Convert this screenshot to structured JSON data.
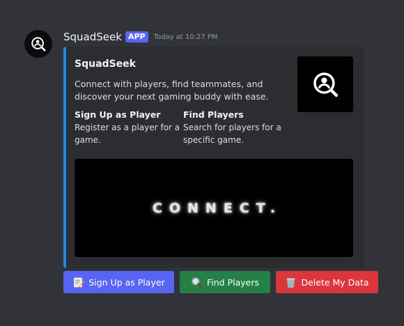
{
  "message": {
    "avatar_icon": "person-search-icon",
    "username": "SquadSeek",
    "badge": "APP",
    "timestamp": "Today at 10:27 PM"
  },
  "embed": {
    "accent_color": "#1e8be0",
    "title": "SquadSeek",
    "description": "Connect with players, find teammates, and discover your next gaming buddy with ease.",
    "thumbnail_icon": "person-search-icon",
    "fields": [
      {
        "name": "Sign Up as Player",
        "value": "Register as a player for a game."
      },
      {
        "name": "Find Players",
        "value": "Search for players for a specific game."
      }
    ],
    "image_text": "CONNECT."
  },
  "buttons": [
    {
      "label": "Sign Up as Player",
      "icon": "memo-icon",
      "color": "#5865f2"
    },
    {
      "label": "Find Players",
      "icon": "magnifying-glass-icon",
      "color": "#248046"
    },
    {
      "label": "Delete My Data",
      "icon": "wastebasket-icon",
      "color": "#da373c"
    }
  ]
}
